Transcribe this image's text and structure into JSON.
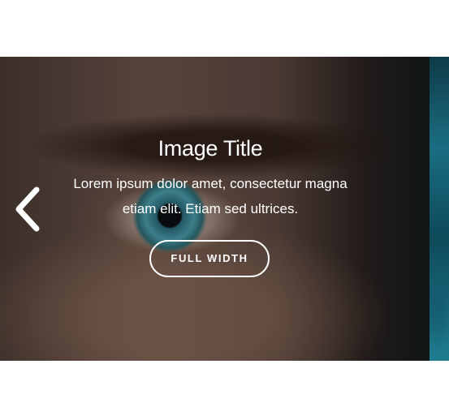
{
  "carousel": {
    "caption": {
      "title": "Image Title",
      "text_line1": "Lorem ipsum dolor amet, consectetur magna",
      "text_line2": "etiam elit. Etiam sed ultrices.",
      "button_label": "FULL WIDTH"
    },
    "nav": {
      "prev_icon": "chevron-left-icon"
    }
  }
}
